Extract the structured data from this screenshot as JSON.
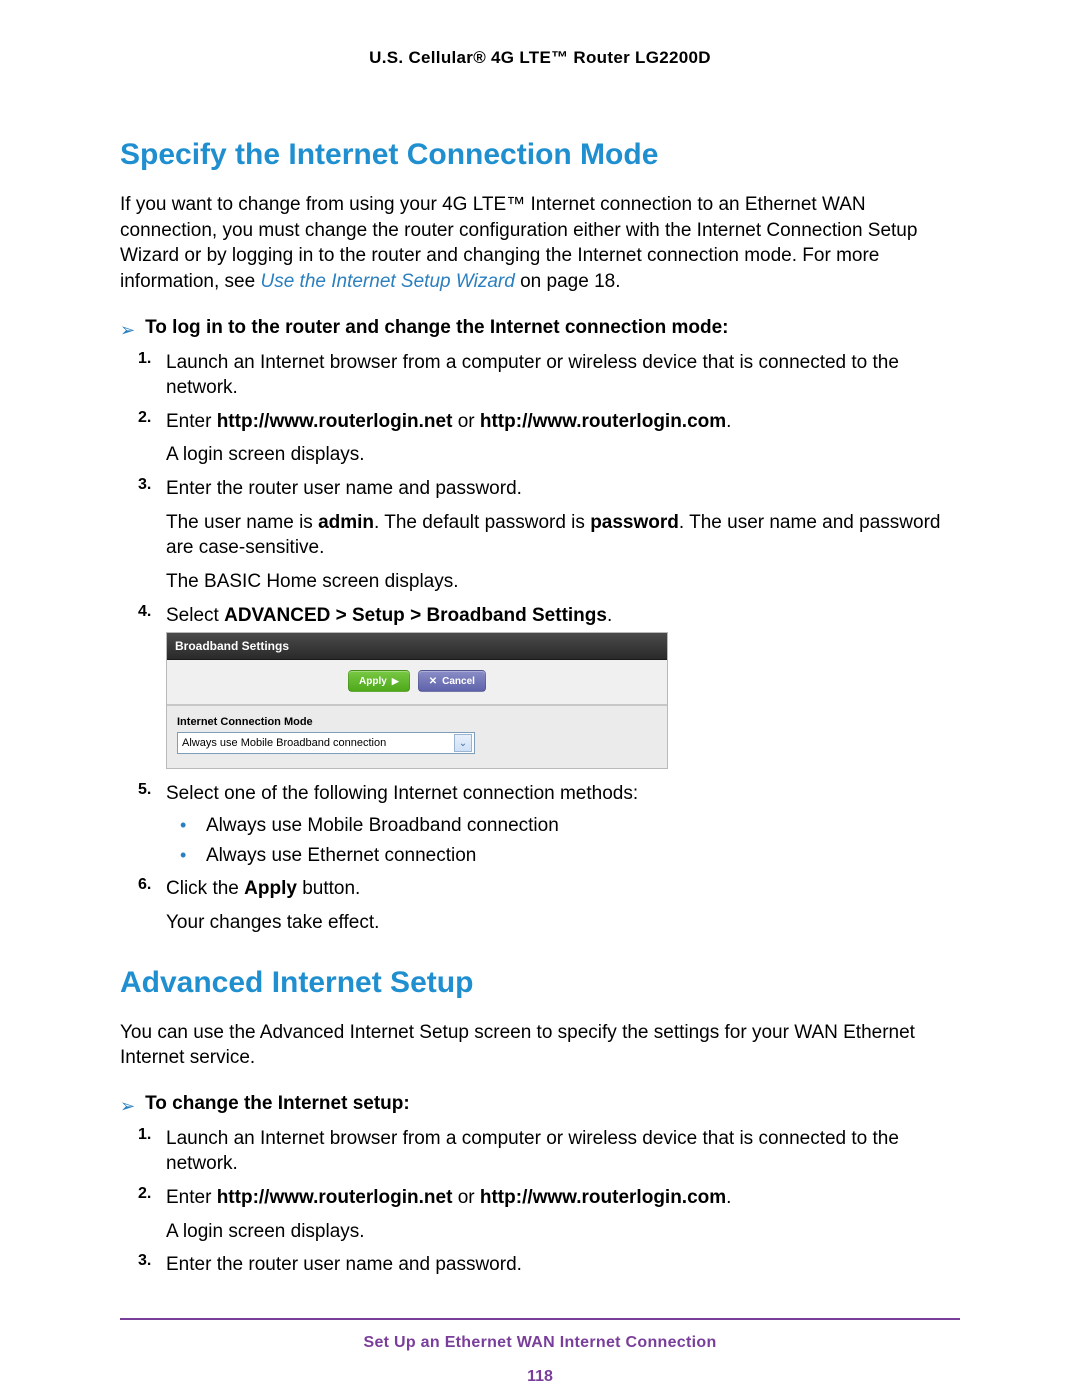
{
  "header": "U.S. Cellular® 4G LTE™ Router LG2200D",
  "h1a": "Specify the Internet Connection Mode",
  "intro_pre": "If you want to change from using your 4G LTE™ Internet connection to an Ethernet WAN connection, you must change the router configuration either with the Internet Connection Setup Wizard or by logging in to the router and changing the Internet connection mode. For more information, see ",
  "intro_link": "Use the Internet Setup Wizard",
  "intro_post": " on page 18.",
  "taskA": "To log in to the router and change the Internet connection mode:",
  "stepA1": "Launch an Internet browser from a computer or wireless device that is connected to the network.",
  "stepA2_pre": "Enter ",
  "stepA2_b1": "http://www.routerlogin.net",
  "stepA2_mid": " or ",
  "stepA2_b2": "http://www.routerlogin.com",
  "stepA2_post": ".",
  "stepA2_sub": "A login screen displays.",
  "stepA3": "Enter the router user name and password.",
  "stepA3_sub1_a": "The user name is ",
  "stepA3_sub1_b": "admin",
  "stepA3_sub1_c": ". The default password is ",
  "stepA3_sub1_d": "password",
  "stepA3_sub1_e": ". The user name and password are case-sensitive.",
  "stepA3_sub2": "The BASIC Home screen displays.",
  "stepA4_pre": "Select ",
  "stepA4_b": "ADVANCED > Setup > Broadband Settings",
  "stepA4_post": ".",
  "panel": {
    "title": "Broadband Settings",
    "apply": "Apply",
    "cancel": "Cancel",
    "field_label": "Internet Connection Mode",
    "select_value": "Always use Mobile Broadband connection"
  },
  "stepA5": "Select one of the following Internet connection methods:",
  "bulletA5_1": "Always use Mobile Broadband connection",
  "bulletA5_2": "Always use Ethernet connection",
  "stepA6_pre": "Click the ",
  "stepA6_b": "Apply",
  "stepA6_post": " button.",
  "stepA6_sub": "Your changes take effect.",
  "h1b": "Advanced Internet Setup",
  "introB": "You can use the Advanced Internet Setup screen to specify the settings for your WAN Ethernet Internet service.",
  "taskB": "To change the Internet setup:",
  "stepB1": "Launch an Internet browser from a computer or wireless device that is connected to the network.",
  "stepB2_pre": "Enter ",
  "stepB2_b1": "http://www.routerlogin.net",
  "stepB2_mid": " or ",
  "stepB2_b2": "http://www.routerlogin.com",
  "stepB2_post": ".",
  "stepB2_sub": "A login screen displays.",
  "stepB3": "Enter the router user name and password.",
  "footer": {
    "title": "Set Up an Ethernet WAN Internet Connection",
    "page": "118"
  }
}
